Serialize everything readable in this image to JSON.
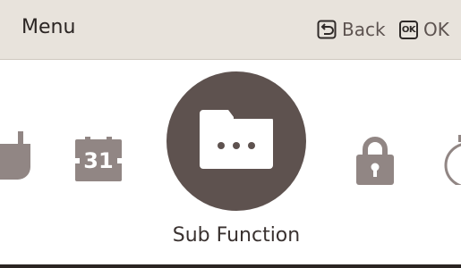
{
  "header": {
    "title": "Menu",
    "back_label": "Back",
    "ok_badge": "OK",
    "ok_label": "OK"
  },
  "carousel": {
    "items": [
      {
        "name": "partial-left-icon",
        "label": ""
      },
      {
        "name": "calendar-icon",
        "label": "31"
      },
      {
        "name": "sub-function-folder-icon",
        "label": "Sub Function",
        "selected": true
      },
      {
        "name": "lock-icon",
        "label": ""
      },
      {
        "name": "partial-right-icon",
        "label": ""
      }
    ],
    "selected_label": "Sub Function"
  },
  "colors": {
    "header_bg": "#e8e3dc",
    "selected_bg": "#5e524f",
    "icon_gray": "#918684"
  }
}
